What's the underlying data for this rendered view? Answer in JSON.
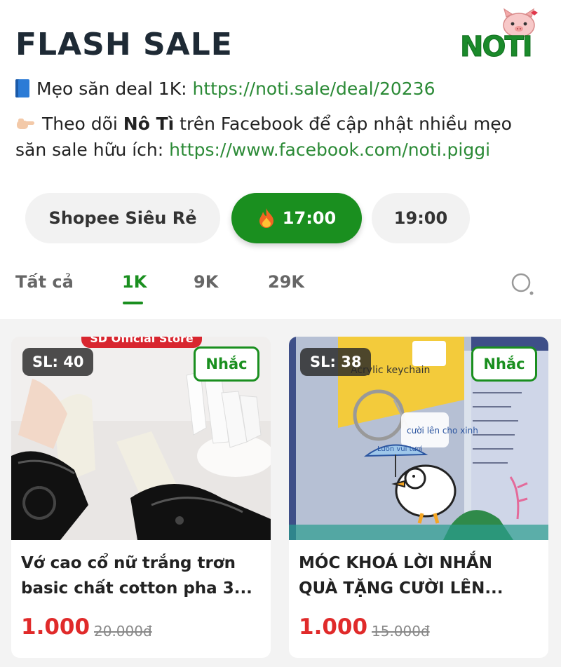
{
  "header": {
    "title": "FLASH SALE",
    "logo_text": "NOTI"
  },
  "tips": {
    "tip1_label": "Mẹo săn deal 1K: ",
    "tip1_link": "https://noti.sale/deal/20236",
    "tip2_prefix": "Theo dõi ",
    "tip2_brand": "Nô Tì",
    "tip2_middle": " trên Facebook để cập nhật nhiều mẹo săn sale hữu ích: ",
    "tip2_link": "https://www.facebook.com/noti.piggi"
  },
  "time_tabs": [
    {
      "label": "Shopee Siêu Rẻ",
      "active": false
    },
    {
      "label": "17:00",
      "active": true,
      "icon": "fire-icon"
    },
    {
      "label": "19:00",
      "active": false
    }
  ],
  "categories": [
    {
      "label": "Tất cả",
      "active": false
    },
    {
      "label": "1K",
      "active": true
    },
    {
      "label": "9K",
      "active": false
    },
    {
      "label": "29K",
      "active": false
    }
  ],
  "products": [
    {
      "stock": "SL: 40",
      "remind_label": "Nhắc",
      "name_line1": "Vớ cao cổ nữ trắng trơn",
      "name_line2": "basic chất cotton pha 3...",
      "price": "1.000",
      "old_price": "20.000đ",
      "store_banner": "SD Official Store"
    },
    {
      "stock": "SL: 38",
      "remind_label": "Nhắc",
      "name_line1": "MÓC KHOÁ LỜI NHẮN",
      "name_line2": "QUÀ TẶNG CƯỜI LÊN...",
      "price": "1.000",
      "old_price": "15.000đ",
      "keychain_text": "Acrylic keychain",
      "tag_text": "cười lên cho xinh",
      "umbrella_text": "Luôn vui tươi"
    }
  ],
  "colors": {
    "brand_green": "#1a8f1f",
    "price_red": "#e02a2a",
    "link_green": "#2b8a36"
  }
}
